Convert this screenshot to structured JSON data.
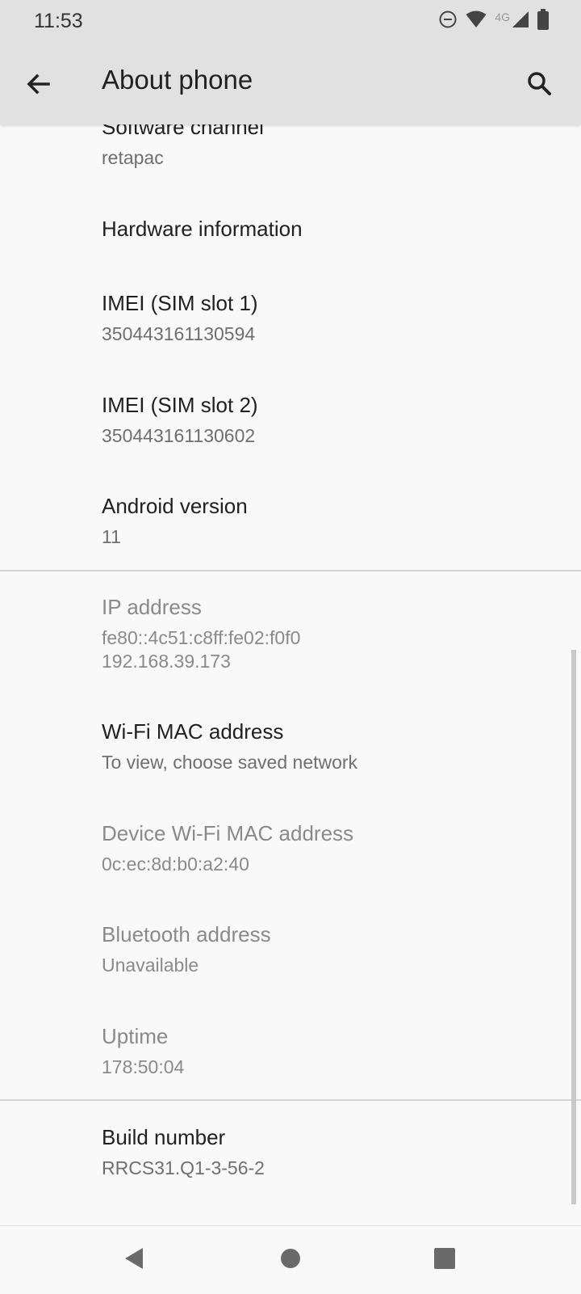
{
  "status_bar": {
    "time": "11:53",
    "network_label": "4G",
    "icons": [
      "do-not-disturb-icon",
      "wifi-icon",
      "cellular-signal-icon",
      "battery-icon"
    ]
  },
  "toolbar": {
    "title": "About phone",
    "back_icon": "arrow-left-icon",
    "search_icon": "search-icon"
  },
  "items": [
    {
      "title": "Software channel",
      "summary": "retapac"
    },
    {
      "title": "Hardware information",
      "summary": ""
    },
    {
      "title": "IMEI (SIM slot 1)",
      "summary": "350443161130594"
    },
    {
      "title": "IMEI (SIM slot 2)",
      "summary": "350443161130602"
    },
    {
      "title": "Android version",
      "summary": "11"
    },
    {
      "title": "IP address",
      "summary": "fe80::4c51:c8ff:fe02:f0f0\n192.168.39.173"
    },
    {
      "title": "Wi-Fi MAC address",
      "summary": "To view, choose saved network"
    },
    {
      "title": "Device Wi-Fi MAC address",
      "summary": "0c:ec:8d:b0:a2:40"
    },
    {
      "title": "Bluetooth address",
      "summary": "Unavailable"
    },
    {
      "title": "Uptime",
      "summary": "178:50:04"
    },
    {
      "title": "Build number",
      "summary": "RRCS31.Q1-3-56-2"
    }
  ],
  "navigation_bar": {
    "icons": [
      "back-triangle-icon",
      "home-circle-icon",
      "recents-square-icon"
    ]
  }
}
